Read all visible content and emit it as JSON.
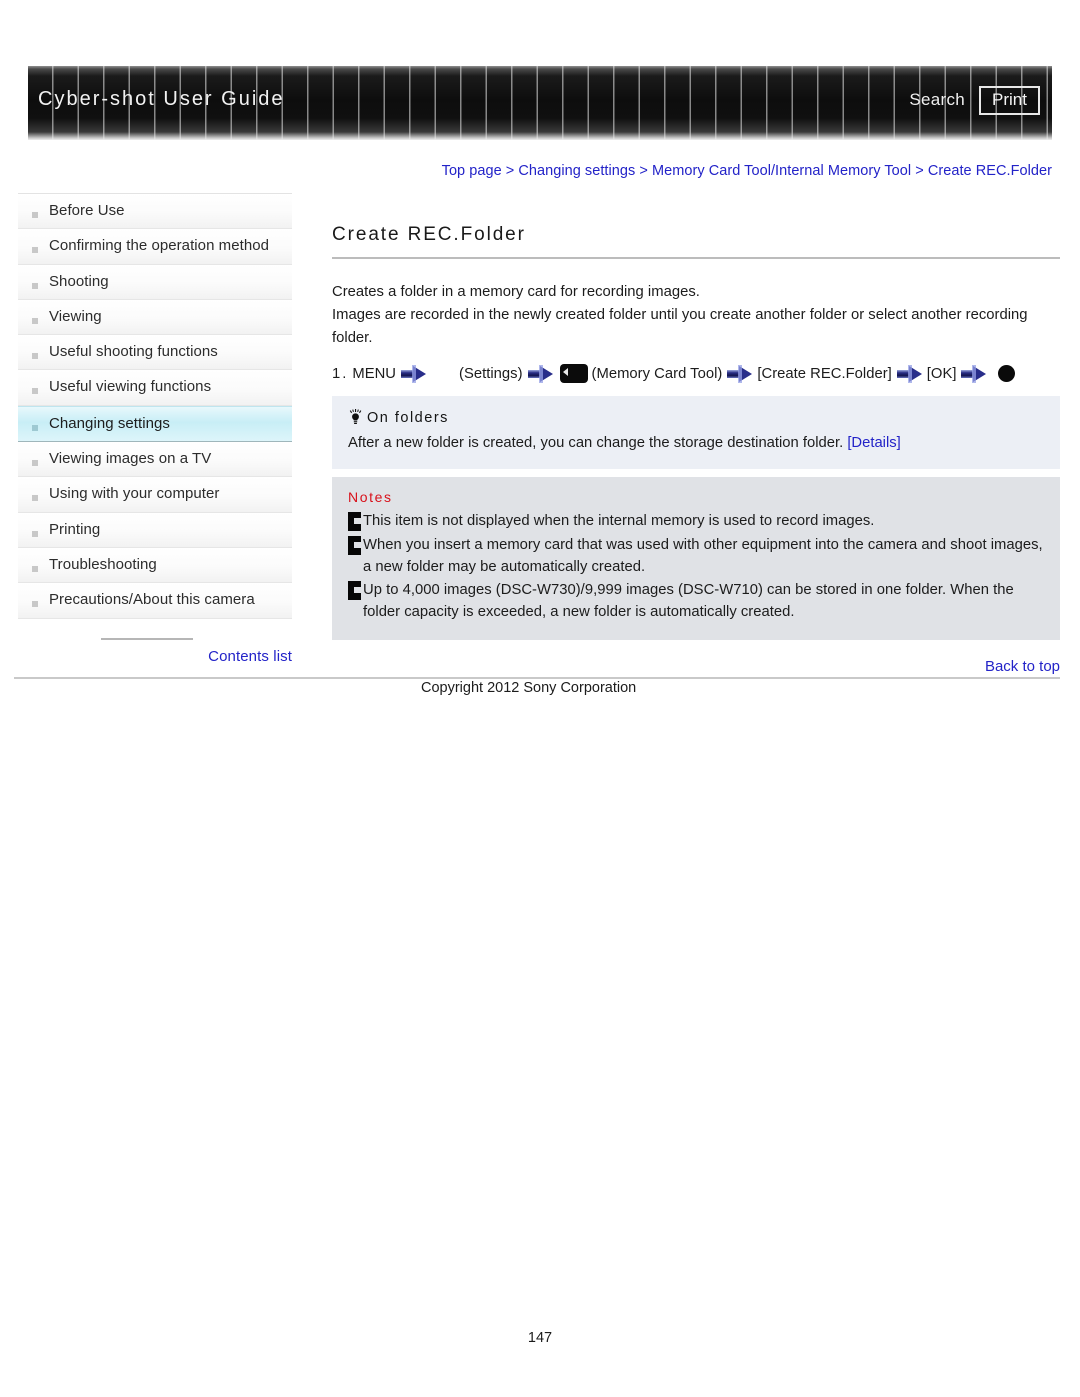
{
  "header": {
    "title": "Cyber-shot User Guide",
    "search_label": "Search",
    "print_label": "Print"
  },
  "breadcrumb": {
    "text": "Top page > Changing settings > Memory Card Tool/Internal Memory Tool > Create REC.Folder"
  },
  "sidebar": {
    "items": [
      {
        "label": "Before Use",
        "active": false
      },
      {
        "label": "Confirming the operation method",
        "active": false
      },
      {
        "label": "Shooting",
        "active": false
      },
      {
        "label": "Viewing",
        "active": false
      },
      {
        "label": "Useful shooting functions",
        "active": false
      },
      {
        "label": "Useful viewing functions",
        "active": false
      },
      {
        "label": "Changing settings",
        "active": true
      },
      {
        "label": "Viewing images on a TV",
        "active": false
      },
      {
        "label": "Using with your computer",
        "active": false
      },
      {
        "label": "Printing",
        "active": false
      },
      {
        "label": "Troubleshooting",
        "active": false
      },
      {
        "label": "Precautions/About this camera",
        "active": false
      }
    ],
    "contents_list_label": "Contents list"
  },
  "main": {
    "title": "Create REC.Folder",
    "paragraph1": "Creates a folder in a memory card for recording images.",
    "paragraph2": "Images are recorded in the newly created folder until you create another folder or select another recording folder.",
    "step": {
      "number": "1.",
      "menu_label": "MENU",
      "settings_label": "(Settings)",
      "memory_card_tool_label": "(Memory Card Tool)",
      "create_rec_folder_label": "[Create REC.Folder]",
      "ok_label": "[OK]"
    },
    "tip": {
      "heading": "On folders",
      "text": "After a new folder is created, you can change the storage destination folder.",
      "link_label": "[Details]"
    },
    "notes": {
      "heading": "Notes",
      "items": [
        "This item is not displayed when the internal memory is used to record images.",
        "When you insert a memory card that was used with other equipment into the camera and shoot images, a new folder may be automatically created.",
        "Up to 4,000 images (DSC-W730)/9,999 images (DSC-W710) can be stored in one folder. When the folder capacity is exceeded, a new folder is automatically created."
      ]
    }
  },
  "footer": {
    "back_to_top_label": "Back to top",
    "copyright": "Copyright 2012 Sony Corporation",
    "page_number": "147"
  },
  "colors": {
    "link": "#2323c8",
    "notes_heading": "#d8101a",
    "active_nav": "#c8eef6",
    "tip_bg": "#eceff5",
    "notes_bg": "#e0e2e6"
  }
}
